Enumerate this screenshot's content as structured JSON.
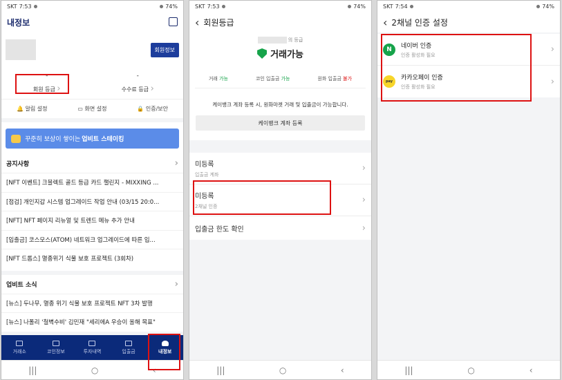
{
  "phone1": {
    "status": {
      "carrier": "SKT",
      "time": "7:53",
      "battery": "74%"
    },
    "title": "내정보",
    "member_info_button": "회원정보",
    "grade_dash_left": "-",
    "grade_dash_right": "-",
    "member_grade": "회원 등급",
    "fee_grade": "수수료 등급",
    "settings": [
      "알림 설정",
      "화면 설정",
      "인증/보안"
    ],
    "banner_text": "꾸준히 보상이 쌓이는",
    "banner_bold": "업비트 스테이킹",
    "notice_title": "공지사항",
    "notices": [
      "[NFT 이벤트] 크블렉트 골드 등급 카드 챌린지 - MIXXING ...",
      "[점검] 개인지갑 시스템 업그레이드 작업 안내 (03/15 20:0...",
      "[NFT] NFT 페이지 리뉴얼 및 트렌드 메뉴 추가 안내",
      "[입출금] 코스모스(ATOM) 네트워크 업그레이드에 따른 입...",
      "[NFT 드롭스] 멸종위기 식물 보호 프로젝트 (3회차)"
    ],
    "upbit_news_title": "업비트 소식",
    "upbit_news": [
      "[뉴스] 두나무, 멸종 위기 식물 보호 프로젝트 NFT 3차 발행",
      "[뉴스] 나폴리 '철벽수비' 김민재 \"세리에A 우승이 올해 목표\""
    ],
    "tabs": [
      "거래소",
      "코인정보",
      "투자내역",
      "입출금",
      "내정보"
    ]
  },
  "phone2": {
    "status": {
      "carrier": "SKT",
      "time": "7:53",
      "battery": "74%"
    },
    "title": "회원등급",
    "grade_suffix": "의 등급",
    "grade_status": "거래가능",
    "perms": [
      {
        "label": "거래",
        "value": "가능"
      },
      {
        "label": "코인 입출금",
        "value": "가능"
      },
      {
        "label": "원화 입출금",
        "value": "불가"
      }
    ],
    "desc": "케이뱅크 계좌 등록 시, 원화마켓 거래 및 입출금이 가능합니다.",
    "register_button": "케이뱅크 계좌 등록",
    "rows": [
      {
        "title": "미등록",
        "sub": "입출금 계좌"
      },
      {
        "title": "미등록",
        "sub": "2채널 인증"
      },
      {
        "title": "입출금 한도 확인",
        "sub": ""
      }
    ]
  },
  "phone3": {
    "status": {
      "carrier": "SKT",
      "time": "7:54",
      "battery": "74%"
    },
    "title": "2채널 인증 설정",
    "rows": [
      {
        "logo": "N",
        "title": "네이버 인증",
        "sub": "인증 활성화 필요"
      },
      {
        "logo": "pay",
        "title": "카카오페이 인증",
        "sub": "인증 활성화 필요"
      }
    ]
  }
}
